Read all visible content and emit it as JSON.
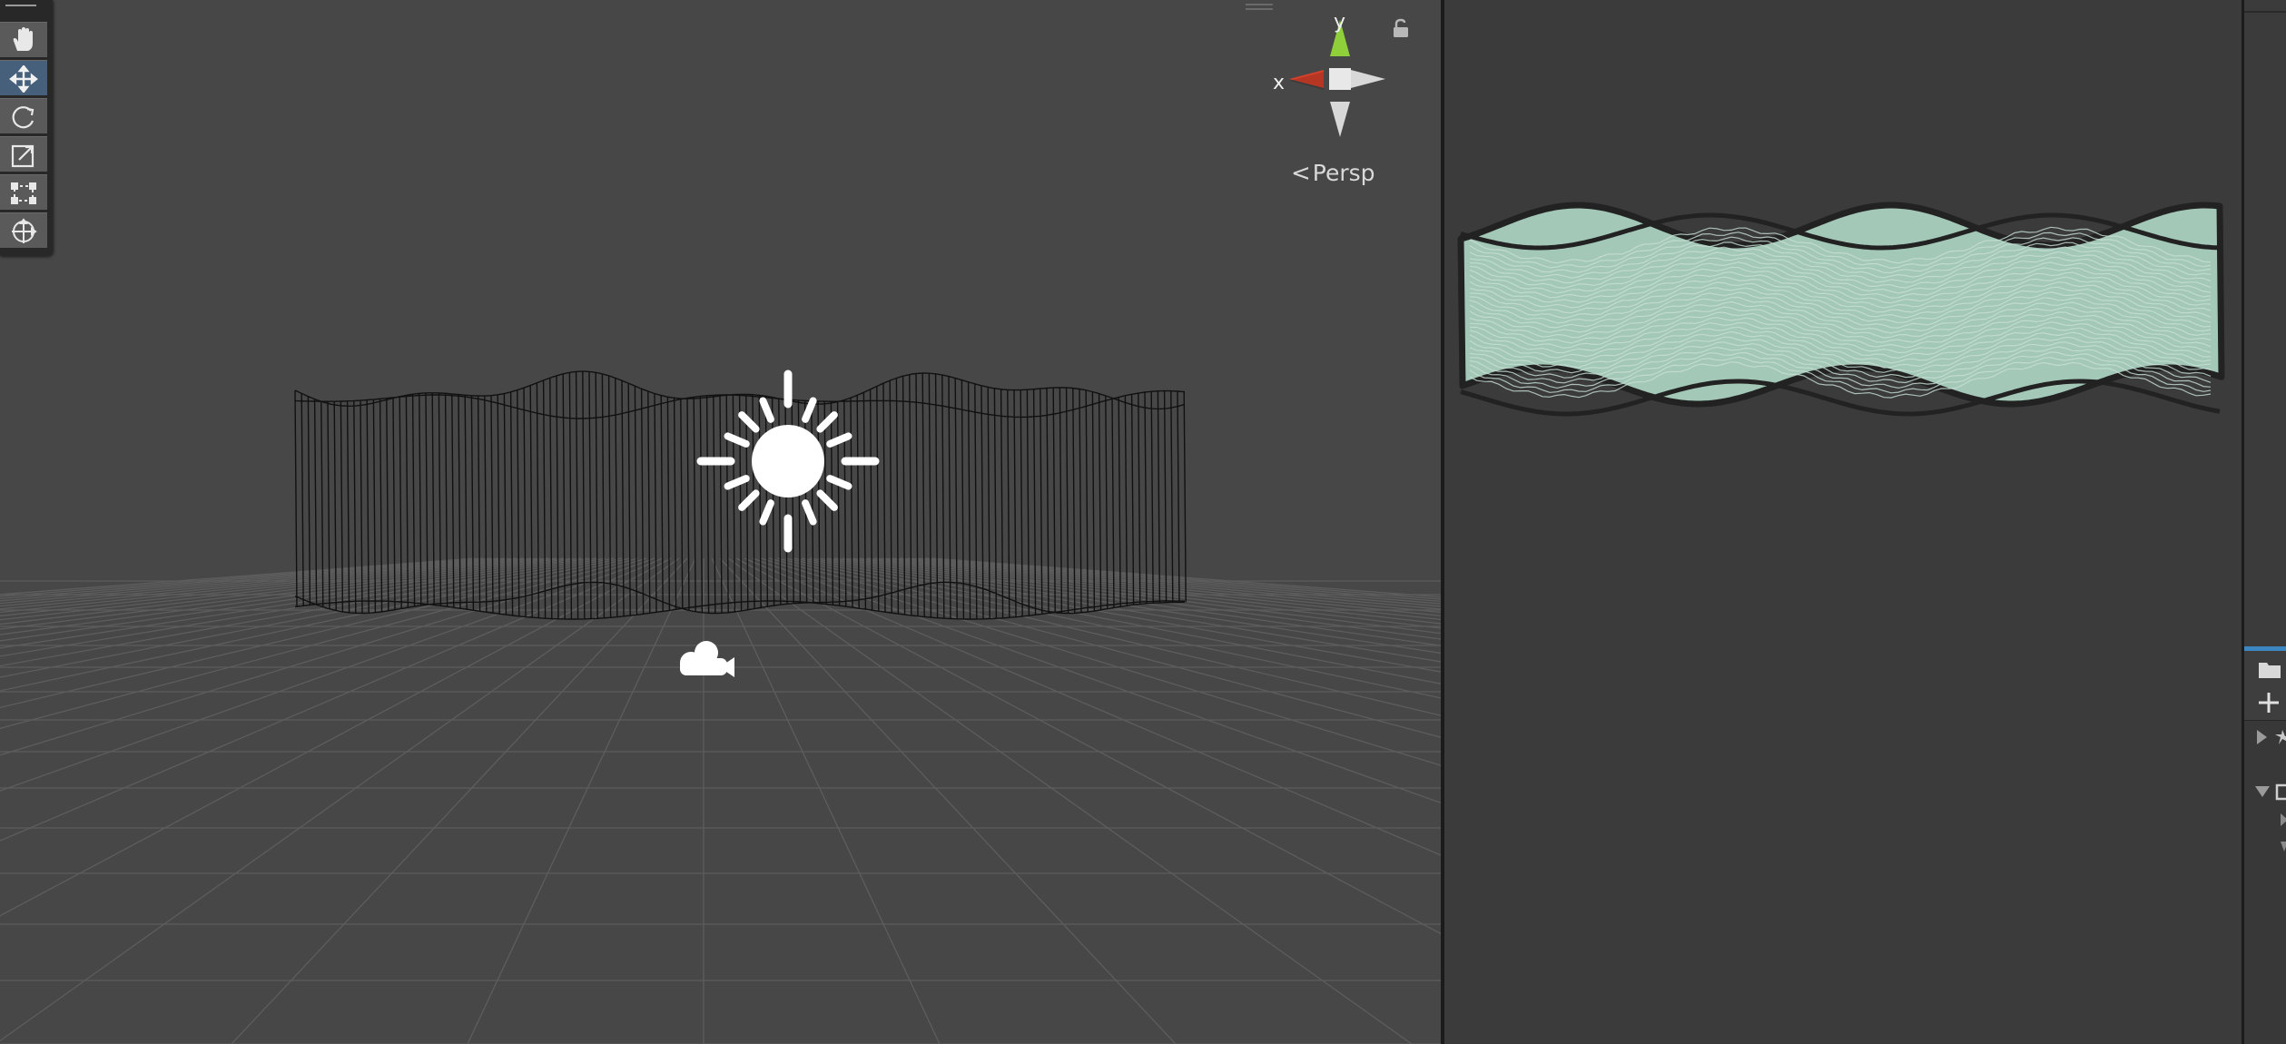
{
  "scene_view": {
    "view_mode": "Persp",
    "axis_labels": {
      "x": "x",
      "y": "y"
    },
    "colors": {
      "background": "#474747",
      "grid_line": "#5c5c5c",
      "wireframe": "#111111",
      "x_axis": "#d6402b",
      "y_axis": "#8fd03a",
      "icon": "#ffffff"
    },
    "tools": [
      {
        "icon": "hand-tool-icon",
        "active": false
      },
      {
        "icon": "move-tool-icon",
        "active": true
      },
      {
        "icon": "rotate-tool-icon",
        "active": false
      },
      {
        "icon": "scale-tool-icon",
        "active": false
      },
      {
        "icon": "rect-tool-icon",
        "active": false
      },
      {
        "icon": "transform-tool-icon",
        "active": false
      }
    ],
    "scene_icons": [
      "directional-light-icon",
      "camera-icon",
      "lock-icon"
    ]
  },
  "preview": {
    "colors": {
      "background": "#3b3b3b",
      "fill": "#a4c8b8",
      "outline": "#222222"
    }
  },
  "right_panel": {
    "icons": [
      "folder-icon",
      "add-icon",
      "star-icon",
      "image-icon"
    ]
  }
}
